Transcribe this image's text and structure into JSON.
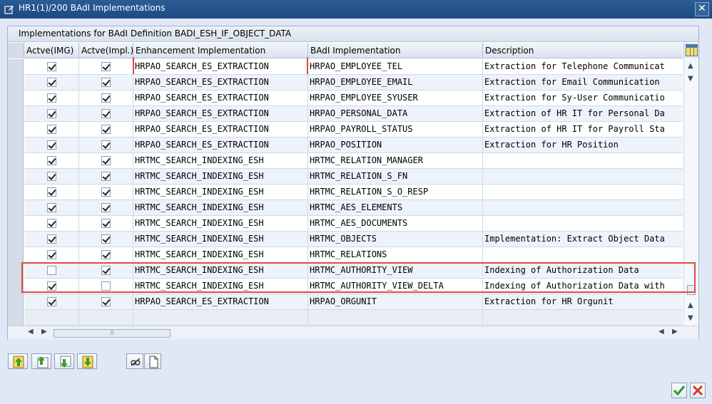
{
  "window": {
    "title": "HR1(1)/200 BAdI Implementations",
    "close_label": "✕"
  },
  "table": {
    "title": "Implementations for BAdI Definition BADI_ESH_IF_OBJECT_DATA",
    "columns": [
      "Actve(IMG)",
      "Actve(Impl.)",
      "Enhancement Implementation",
      "BAdI Implementation",
      "Description"
    ],
    "rows": [
      {
        "img": true,
        "impl": true,
        "enh": "HRPAO_SEARCH_ES_EXTRACTION",
        "badi": "HRPAO_EMPLOYEE_TEL",
        "desc": "Extraction for Telephone Communicat"
      },
      {
        "img": true,
        "impl": true,
        "enh": "HRPAO_SEARCH_ES_EXTRACTION",
        "badi": "HRPAO_EMPLOYEE_EMAIL",
        "desc": "Extraction for Email Communication"
      },
      {
        "img": true,
        "impl": true,
        "enh": "HRPAO_SEARCH_ES_EXTRACTION",
        "badi": "HRPAO_EMPLOYEE_SYUSER",
        "desc": "Extraction for Sy-User Communicatio"
      },
      {
        "img": true,
        "impl": true,
        "enh": "HRPAO_SEARCH_ES_EXTRACTION",
        "badi": "HRPAO_PERSONAL_DATA",
        "desc": "Extraction of HR IT for Personal Da"
      },
      {
        "img": true,
        "impl": true,
        "enh": "HRPAO_SEARCH_ES_EXTRACTION",
        "badi": "HRPAO_PAYROLL_STATUS",
        "desc": "Extraction of HR IT for Payroll Sta"
      },
      {
        "img": true,
        "impl": true,
        "enh": "HRPAO_SEARCH_ES_EXTRACTION",
        "badi": "HRPAO_POSITION",
        "desc": "Extraction for HR Position"
      },
      {
        "img": true,
        "impl": true,
        "enh": "HRTMC_SEARCH_INDEXING_ESH",
        "badi": "HRTMC_RELATION_MANAGER",
        "desc": ""
      },
      {
        "img": true,
        "impl": true,
        "enh": "HRTMC_SEARCH_INDEXING_ESH",
        "badi": "HRTMC_RELATION_S_FN",
        "desc": ""
      },
      {
        "img": true,
        "impl": true,
        "enh": "HRTMC_SEARCH_INDEXING_ESH",
        "badi": "HRTMC_RELATION_S_O_RESP",
        "desc": ""
      },
      {
        "img": true,
        "impl": true,
        "enh": "HRTMC_SEARCH_INDEXING_ESH",
        "badi": "HRTMC_AES_ELEMENTS",
        "desc": ""
      },
      {
        "img": true,
        "impl": true,
        "enh": "HRTMC_SEARCH_INDEXING_ESH",
        "badi": "HRTMC_AES_DOCUMENTS",
        "desc": ""
      },
      {
        "img": true,
        "impl": true,
        "enh": "HRTMC_SEARCH_INDEXING_ESH",
        "badi": "HRTMC_OBJECTS",
        "desc": "Implementation: Extract Object Data"
      },
      {
        "img": true,
        "impl": true,
        "enh": "HRTMC_SEARCH_INDEXING_ESH",
        "badi": "HRTMC_RELATIONS",
        "desc": ""
      },
      {
        "img": false,
        "impl": true,
        "enh": "HRTMC_SEARCH_INDEXING_ESH",
        "badi": "HRTMC_AUTHORITY_VIEW",
        "desc": "Indexing of Authorization Data"
      },
      {
        "img": true,
        "impl": false,
        "enh": "HRTMC_SEARCH_INDEXING_ESH",
        "badi": "HRTMC_AUTHORITY_VIEW_DELTA",
        "desc": "Indexing of Authorization Data with"
      },
      {
        "img": true,
        "impl": true,
        "enh": "HRPAO_SEARCH_ES_EXTRACTION",
        "badi": "HRPAO_ORGUNIT",
        "desc": "Extraction for HR Orgunit"
      },
      {
        "img": false,
        "impl": false,
        "enh": "",
        "badi": "",
        "desc": "",
        "blank": true
      }
    ]
  },
  "icons": {
    "title": "window-edit-icon",
    "toolbar": [
      "move-top-icon",
      "move-up-icon",
      "move-down-icon",
      "move-bottom-icon",
      "display-change-icon",
      "new-document-icon"
    ],
    "footer": [
      "confirm-icon",
      "cancel-icon"
    ]
  },
  "colors": {
    "titlebar": "#1d4a80",
    "highlight": "#e24c3f",
    "confirm": "#2d9a1e",
    "cancel": "#d23a22"
  }
}
